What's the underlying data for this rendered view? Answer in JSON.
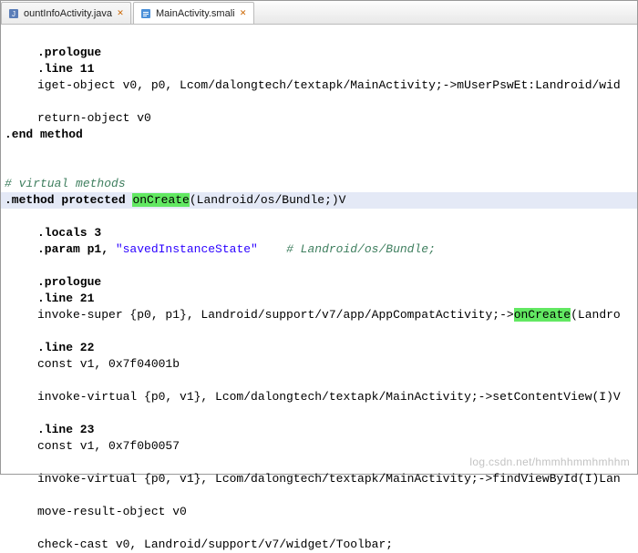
{
  "tabs": [
    {
      "label": "ountInfoActivity.java",
      "iconColor": "#5a7db8",
      "active": false
    },
    {
      "label": "MainActivity.smali",
      "iconColor": "#4a90d9",
      "active": true
    }
  ],
  "code": {
    "l1": ".prologue",
    "l2": ".line 11",
    "l3": "iget-object v0, p0, Lcom/dalongtech/textapk/MainActivity;->mUserPswEt:Landroid/wid",
    "l4": "",
    "l5": "return-object v0",
    "l6": ".end method",
    "l7": "",
    "l8": "",
    "l9": "# virtual methods",
    "l10a": ".method protected ",
    "l10b": "onCreate",
    "l10c": "(Landroid/os/Bundle;)V",
    "l11": ".locals 3",
    "l12a": ".param p1, ",
    "l12b": "\"savedInstanceState\"",
    "l12c": "    # Landroid/os/Bundle;",
    "l13": "",
    "l14": ".prologue",
    "l15": ".line 21",
    "l16a": "invoke-super {p0, p1}, Landroid/support/v7/app/AppCompatActivity;->",
    "l16b": "onCreate",
    "l16c": "(Landro",
    "l17": "",
    "l18": ".line 22",
    "l19": "const v1, 0x7f04001b",
    "l20": "",
    "l21": "invoke-virtual {p0, v1}, Lcom/dalongtech/textapk/MainActivity;->setContentView(I)V",
    "l22": "",
    "l23": ".line 23",
    "l24": "const v1, 0x7f0b0057",
    "l25": "",
    "l26": "invoke-virtual {p0, v1}, Lcom/dalongtech/textapk/MainActivity;->findViewById(I)Lan",
    "l27": "",
    "l28": "move-result-object v0",
    "l29": "",
    "l30": "check-cast v0, Landroid/support/v7/widget/Toolbar;"
  },
  "watermark": "log.csdn.net/hmmhhmmhmhhm"
}
